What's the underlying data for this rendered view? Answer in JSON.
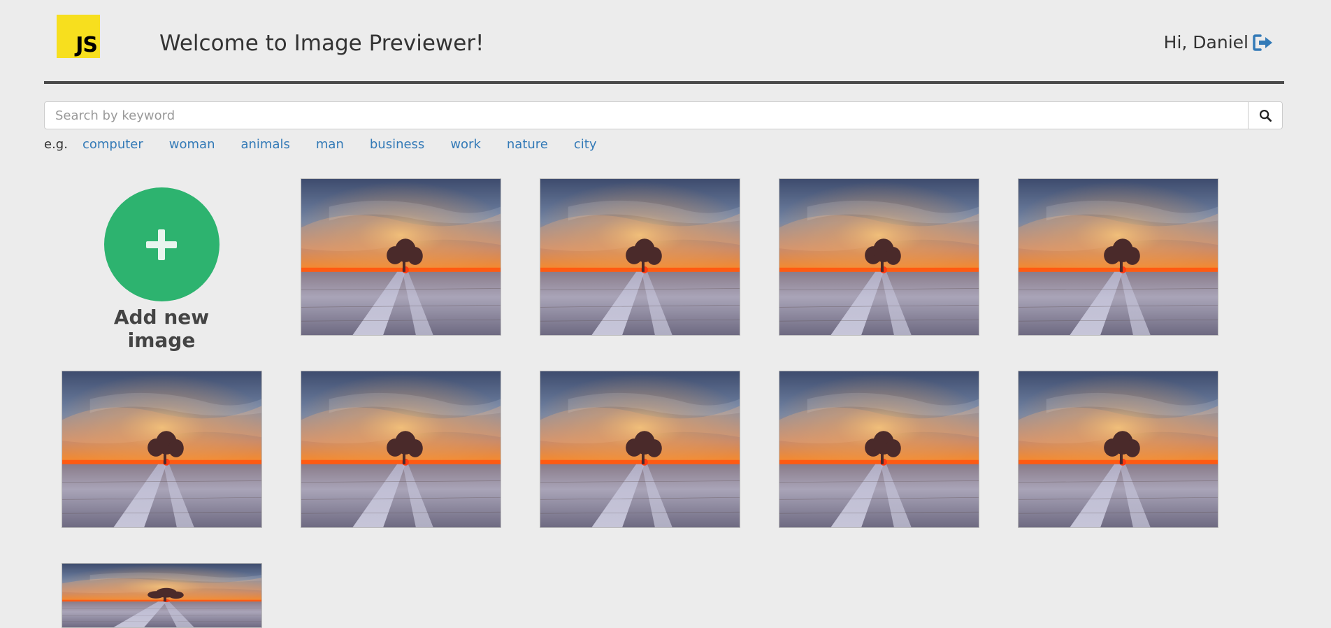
{
  "header": {
    "logo_text": "JS",
    "title": "Welcome to Image Previewer!",
    "greeting": "Hi, Daniel",
    "logout_icon": "sign-out-icon"
  },
  "search": {
    "placeholder": "Search by keyword",
    "value": "",
    "button_icon": "search-icon"
  },
  "examples": {
    "prefix": "e.g.",
    "keywords": [
      "computer",
      "woman",
      "animals",
      "man",
      "business",
      "work",
      "nature",
      "city"
    ]
  },
  "add_new": {
    "label": "Add new image",
    "icon": "plus-icon",
    "color": "#2db36f"
  },
  "gallery": {
    "image_count": 10
  },
  "colors": {
    "background": "#ececec",
    "link": "#337ab7",
    "logo": "#f7df1e",
    "divider": "#4a4a4a"
  }
}
